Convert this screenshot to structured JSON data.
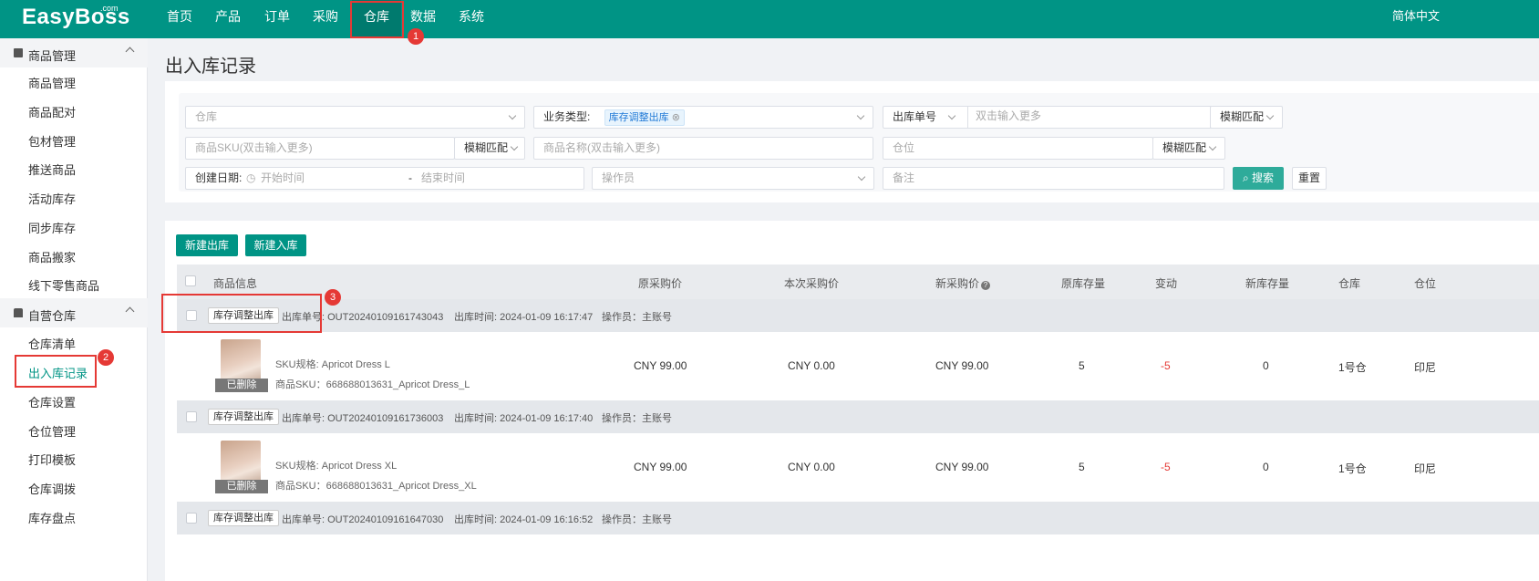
{
  "nav": {
    "logo": "EasyBoss",
    "logo_suffix": ".com",
    "items": [
      "首页",
      "产品",
      "订单",
      "采购",
      "仓库",
      "数据",
      "系统"
    ],
    "active": "仓库",
    "language": "简体中文"
  },
  "sidebar": {
    "group1": {
      "title": "商品管理",
      "items": [
        "商品管理",
        "商品配对",
        "包材管理",
        "推送商品",
        "活动库存",
        "同步库存",
        "商品搬家",
        "线下零售商品"
      ]
    },
    "group2": {
      "title": "自营仓库",
      "items": [
        "仓库清单",
        "出入库记录",
        "仓库设置",
        "仓位管理",
        "打印模板",
        "仓库调拨",
        "库存盘点"
      ]
    },
    "active_item": "出入库记录"
  },
  "page": {
    "title": "出入库记录"
  },
  "filters": {
    "warehouse_placeholder": "仓库",
    "biz_type_label": "业务类型:",
    "biz_type_tag": "库存调整出库",
    "order_no_label": "出库单号",
    "order_no_placeholder": "双击输入更多",
    "match_mode": "模糊匹配",
    "sku_placeholder": "商品SKU(双击输入更多)",
    "sku_match": "模糊匹配",
    "name_placeholder": "商品名称(双击输入更多)",
    "location_placeholder": "仓位",
    "location_match": "模糊匹配",
    "date_label": "创建日期:",
    "start_placeholder": "开始时间",
    "date_sep": "-",
    "end_placeholder": "结束时间",
    "operator_placeholder": "操作员",
    "remark_placeholder": "备注",
    "search_label": "搜索",
    "reset_label": "重置"
  },
  "actions": {
    "new_out": "新建出库",
    "new_in": "新建入库"
  },
  "table": {
    "headers": [
      "商品信息",
      "原采购价",
      "本次采购价",
      "新采购价",
      "原库存量",
      "变动",
      "新库存量",
      "仓库",
      "仓位"
    ],
    "groups": [
      {
        "tag": "库存调整出库",
        "order_no": "出库单号: OUT20240109161743043",
        "time": "出库时间: 2024-01-09 16:17:47",
        "operator": "操作员：主账号",
        "item": {
          "deleted": "已删除",
          "spec": "SKU规格:   Apricot Dress L",
          "sku": "商品SKU：668688013631_Apricot Dress_L",
          "orig_price": "CNY 99.00",
          "this_price": "CNY 0.00",
          "new_price": "CNY 99.00",
          "orig_stock": "5",
          "change": "-5",
          "new_stock": "0",
          "warehouse": "1号仓",
          "location": "印尼"
        }
      },
      {
        "tag": "库存调整出库",
        "order_no": "出库单号: OUT20240109161736003",
        "time": "出库时间: 2024-01-09 16:17:40",
        "operator": "操作员：主账号",
        "item": {
          "deleted": "已删除",
          "spec": "SKU规格:   Apricot Dress XL",
          "sku": "商品SKU：668688013631_Apricot Dress_XL",
          "orig_price": "CNY 99.00",
          "this_price": "CNY 0.00",
          "new_price": "CNY 99.00",
          "orig_stock": "5",
          "change": "-5",
          "new_stock": "0",
          "warehouse": "1号仓",
          "location": "印尼"
        }
      },
      {
        "tag": "库存调整出库",
        "order_no": "出库单号: OUT20240109161647030",
        "time": "出库时间: 2024-01-09 16:16:52",
        "operator": "操作员：主账号"
      }
    ]
  },
  "annotations": [
    "1",
    "2",
    "3"
  ],
  "colors": {
    "brand": "#009485",
    "annotation": "#e53935",
    "negative": "#e53935"
  }
}
